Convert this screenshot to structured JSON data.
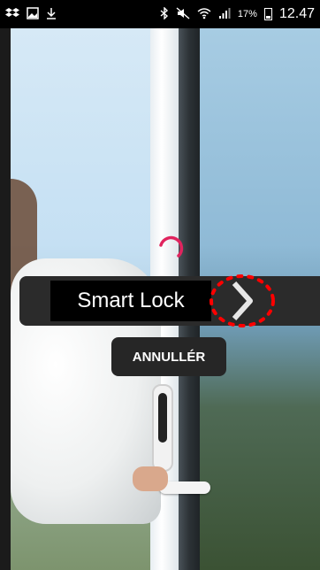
{
  "status_bar": {
    "left_icons": [
      "dropbox-icon",
      "image-icon",
      "download-icon"
    ],
    "right_icons": [
      "bluetooth-icon",
      "mute-icon",
      "wifi-icon",
      "signal-icon",
      "battery-icon"
    ],
    "battery_percent": "17%",
    "time": "12.47"
  },
  "loader": {
    "accent_color": "#e0245e"
  },
  "lock_bar": {
    "label": "Smart Lock",
    "chevron_color": "#e7e7e7",
    "highlight_color": "#ff0000"
  },
  "cancel_button": {
    "label": "ANNULLÉR"
  }
}
